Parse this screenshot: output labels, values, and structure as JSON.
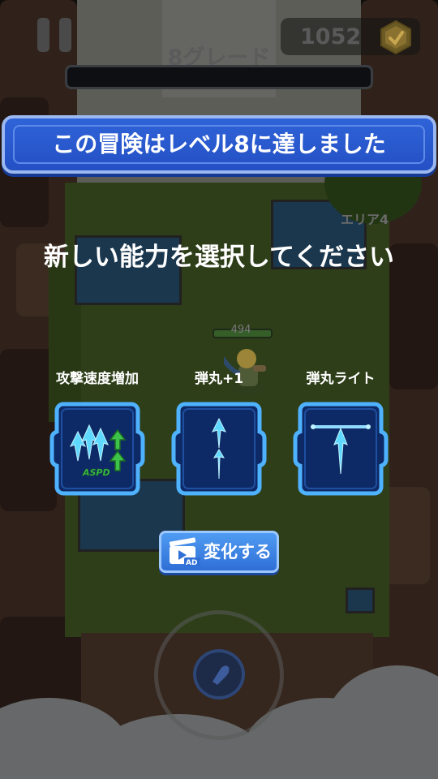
{
  "hud": {
    "coins": "1052",
    "grade": "8グレード"
  },
  "banner": {
    "title": "この冒険はレベル8に達しました"
  },
  "area": "エリア4",
  "prompt": "新しい能力を選択してください",
  "hero": {
    "hp": "494"
  },
  "skills": [
    {
      "label": "攻撃速度増加",
      "icon": "attack-speed-icon",
      "badge": "ASPD"
    },
    {
      "label": "弾丸+1",
      "icon": "bullet-plus-icon"
    },
    {
      "label": "弾丸ライト",
      "icon": "bullet-right-icon"
    }
  ],
  "change_button": {
    "label": "変化する",
    "badge": "AD"
  },
  "colors": {
    "banner": "#2f63d8",
    "card_border": "#4fb2ff",
    "card_bg": "#0e2a66",
    "arrow": "#5fd8ff",
    "accent_green": "#3dc24a"
  }
}
